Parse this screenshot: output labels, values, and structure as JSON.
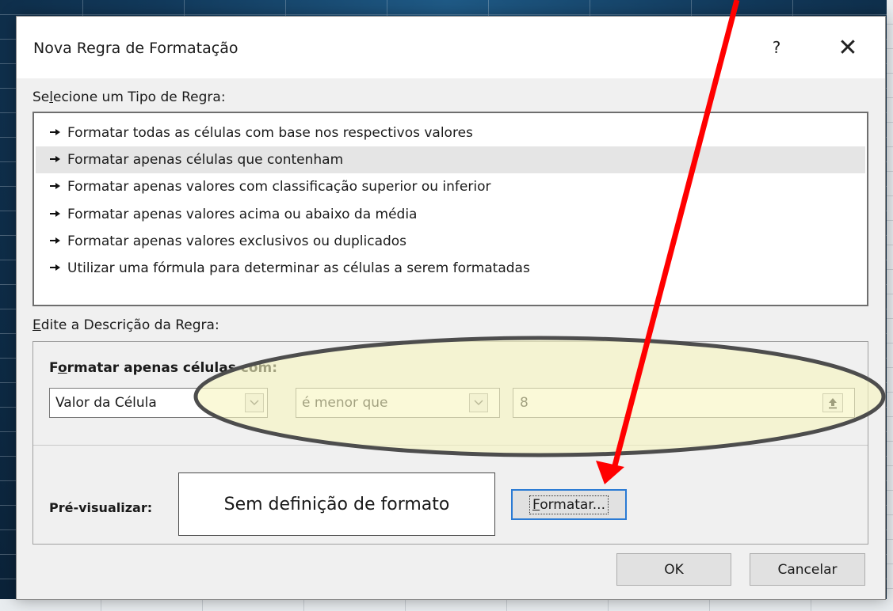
{
  "dialog": {
    "title": "Nova Regra de Formatação",
    "help_label": "?",
    "close_label": "✕"
  },
  "rule_type": {
    "label_pre": "Se",
    "label_ul": "l",
    "label_post": "ecione um Tipo de Regra:",
    "items": [
      {
        "label": "Formatar todas as células com base nos respectivos valores",
        "selected": false
      },
      {
        "label": "Formatar apenas células que contenham",
        "selected": true
      },
      {
        "label": "Formatar apenas valores com classificação superior ou inferior",
        "selected": false
      },
      {
        "label": "Formatar apenas valores acima ou abaixo da média",
        "selected": false
      },
      {
        "label": "Formatar apenas valores exclusivos ou duplicados",
        "selected": false
      },
      {
        "label": "Utilizar uma fórmula para determinar as células a serem formatadas",
        "selected": false
      }
    ],
    "item_icon": "arrow-bullet-icon"
  },
  "description": {
    "label_ul": "E",
    "label_post": "dite a Descrição da Regra:",
    "condition_label_pre": "F",
    "condition_label_ul": "o",
    "condition_label_post": "rmatar apenas células com:",
    "field_select": "Valor da Célula",
    "operator_select": "é menor que",
    "value": "8",
    "range_icon": "collapse-dialog-icon",
    "preview_label": "Pré-visualizar:",
    "preview_text": "Sem definição de formato",
    "format_button_ul": "F",
    "format_button_post": "ormatar..."
  },
  "buttons": {
    "ok": "OK",
    "cancel": "Cancelar"
  },
  "annotations": {
    "highlight_color": "#f7f5c0",
    "arrow_color": "#ff0000"
  }
}
